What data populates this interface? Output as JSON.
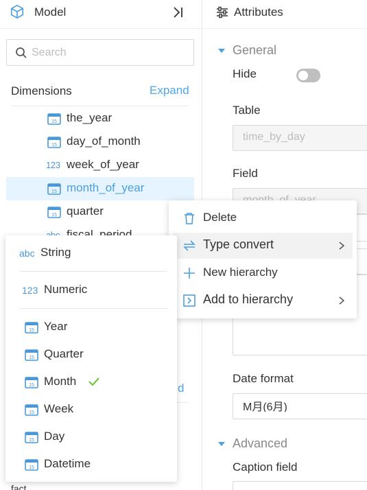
{
  "left_panel": {
    "title": "Model",
    "search_placeholder": "Search",
    "dimensions_title": "Dimensions",
    "expand_label": "Expand",
    "items": [
      {
        "label": "the_year",
        "icon": "calendar-icon",
        "icon_text": "15"
      },
      {
        "label": "day_of_month",
        "icon": "calendar-icon",
        "icon_text": "15"
      },
      {
        "label": "week_of_year",
        "icon": "numeric-icon",
        "icon_text": "123"
      },
      {
        "label": "month_of_year",
        "icon": "calendar-icon",
        "icon_text": "15",
        "selected": true
      },
      {
        "label": "quarter",
        "icon": "calendar-icon",
        "icon_text": "15"
      },
      {
        "label": "fiscal_period",
        "icon": "string-icon",
        "icon_text": "abc"
      }
    ],
    "hidden_link": "d",
    "hidden_bottom": "fact"
  },
  "right_panel": {
    "title": "Attributes",
    "general_title": "General",
    "hide_label": "Hide",
    "hide_value": false,
    "table_label": "Table",
    "table_value": "time_by_day",
    "field_label": "Field",
    "field_value": "month_of_year",
    "date_format_label": "Date format",
    "date_format_value": "M月(6月)",
    "advanced_title": "Advanced",
    "caption_field_label": "Caption field"
  },
  "context_menu": {
    "items": [
      {
        "label": "Delete",
        "icon": "trash-icon"
      },
      {
        "label": "Type convert",
        "icon": "convert-icon",
        "submenu": true,
        "active": true
      },
      {
        "label": "New hierarchy",
        "icon": "plus-icon"
      },
      {
        "label": "Add to hierarchy",
        "icon": "add-to-icon",
        "submenu": true
      }
    ]
  },
  "type_menu": {
    "string_label": "String",
    "string_icon_text": "abc",
    "numeric_label": "Numeric",
    "numeric_icon_text": "123",
    "date_items": [
      "Year",
      "Quarter",
      "Month",
      "Week",
      "Day",
      "Datetime"
    ],
    "calendar_icon_text": "15",
    "selected": "Month"
  },
  "colors": {
    "accent": "#4a9fe0",
    "selected_bg": "#e6f4ff",
    "check": "#52c41a",
    "toggle_off": "#bfbfbf"
  }
}
